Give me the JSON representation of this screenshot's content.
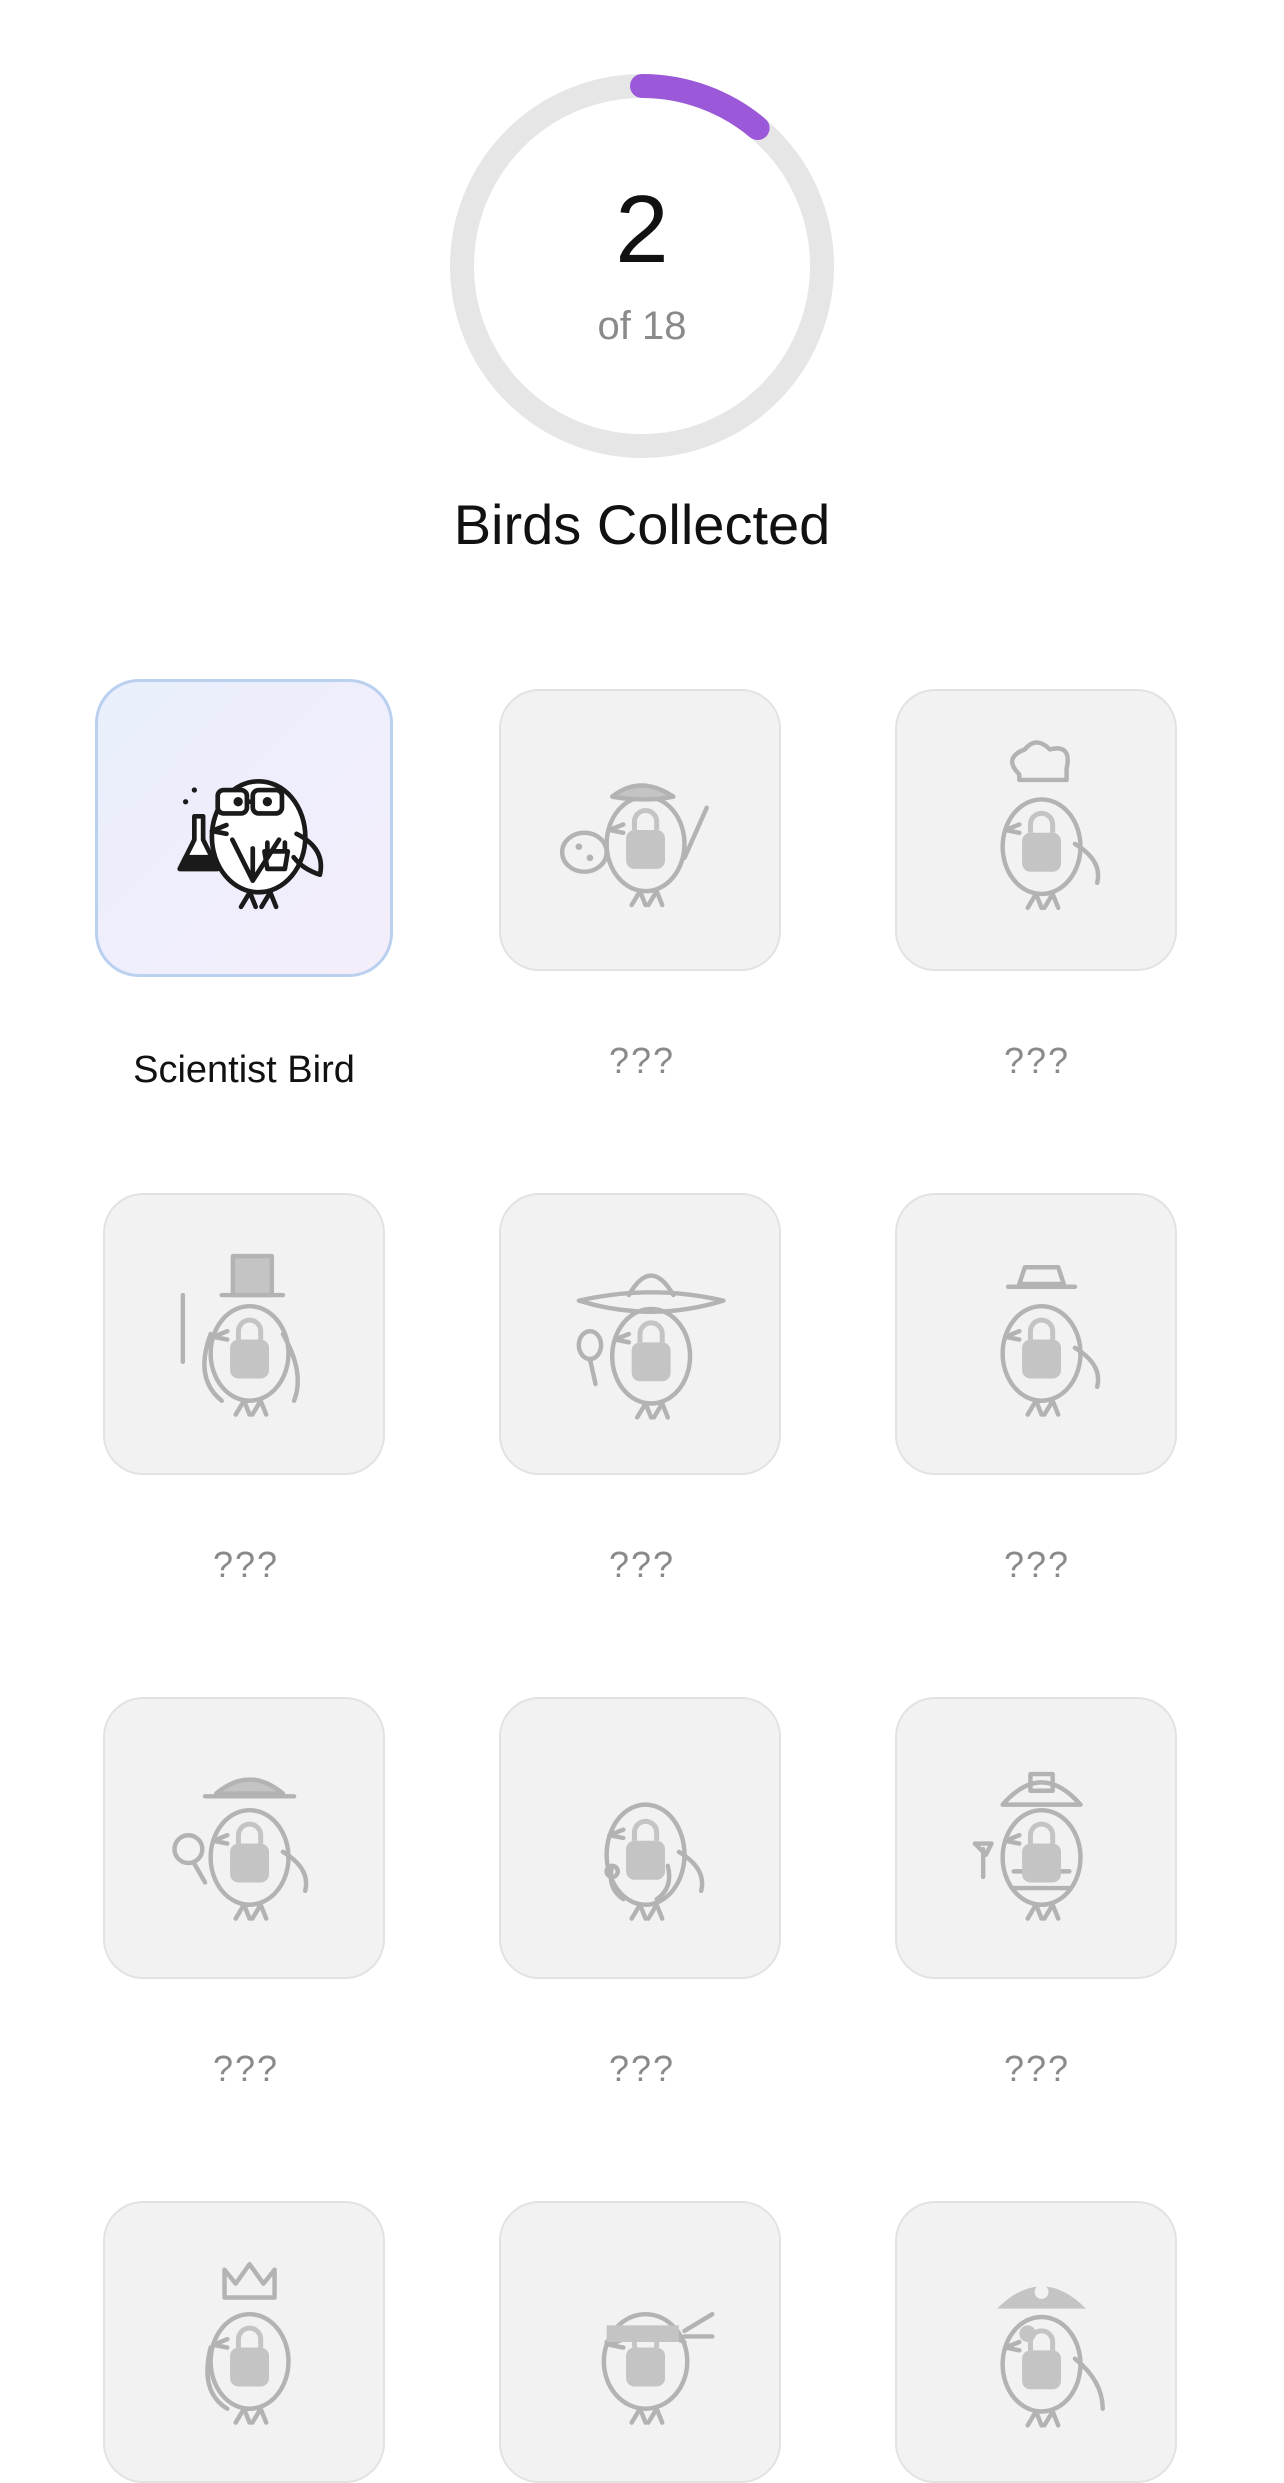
{
  "progress": {
    "collected": "2",
    "total_text": "of 18",
    "fraction": 0.111,
    "accent_color": "#9b59d9"
  },
  "title": "Birds Collected",
  "birds": [
    {
      "label": "Scientist Bird",
      "unlocked": true,
      "icon": "scientist-bird-icon"
    },
    {
      "label": "???",
      "unlocked": false,
      "icon": "painter-bird-icon"
    },
    {
      "label": "???",
      "unlocked": false,
      "icon": "chef-bird-icon"
    },
    {
      "label": "???",
      "unlocked": false,
      "icon": "magician-bird-icon"
    },
    {
      "label": "???",
      "unlocked": false,
      "icon": "mariachi-bird-icon"
    },
    {
      "label": "???",
      "unlocked": false,
      "icon": "fancy-bird-icon"
    },
    {
      "label": "???",
      "unlocked": false,
      "icon": "detective-bird-icon"
    },
    {
      "label": "???",
      "unlocked": false,
      "icon": "doctor-bird-icon"
    },
    {
      "label": "???",
      "unlocked": false,
      "icon": "firefighter-bird-icon"
    },
    {
      "label": "",
      "unlocked": false,
      "icon": "king-bird-icon"
    },
    {
      "label": "",
      "unlocked": false,
      "icon": "ninja-bird-icon"
    },
    {
      "label": "",
      "unlocked": false,
      "icon": "pirate-bird-icon"
    }
  ]
}
